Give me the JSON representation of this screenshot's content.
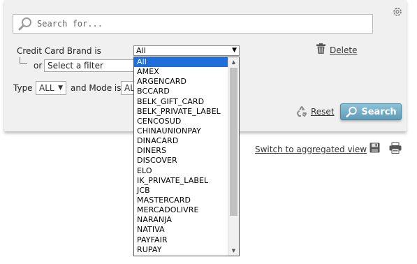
{
  "search": {
    "placeholder": "Search for..."
  },
  "filter": {
    "brand_label": "Credit Card Brand is",
    "brand_selected": "All",
    "or_label": "or",
    "filter_placeholder": "Select a filter",
    "delete_label": "Delete"
  },
  "type_row": {
    "type_label": "Type",
    "type_selected": "ALL",
    "mode_label": "and Mode is",
    "mode_selected": "AL"
  },
  "actions": {
    "reset_label": "Reset",
    "search_label": "Search",
    "switch_label": "Switch to aggregated view",
    "separator": "·"
  },
  "dropdown": {
    "options": [
      "All",
      "AMEX",
      "ARGENCARD",
      "BCCARD",
      "BELK_GIFT_CARD",
      "BELK_PRIVATE_LABEL",
      "CENCOSUD",
      "CHINAUNIONPAY",
      "DINACARD",
      "DINERS",
      "DISCOVER",
      "ELO",
      "IK_PRIVATE_LABEL",
      "JCB",
      "MASTERCARD",
      "MERCADOLIVRE",
      "NARANJA",
      "NATIVA",
      "PAYFAIR",
      "RUPAY"
    ]
  },
  "icons": {
    "corner": "settings-puzzle-icon",
    "search": "magnifier-icon",
    "delete": "trash-icon",
    "reset": "recycle-icon",
    "save": "floppy-disk-icon",
    "print": "printer-icon"
  },
  "colors": {
    "panel_bg": "#f0f0f0",
    "search_button": "#6aa7c3",
    "dropdown_selected": "#1e6fd9"
  }
}
